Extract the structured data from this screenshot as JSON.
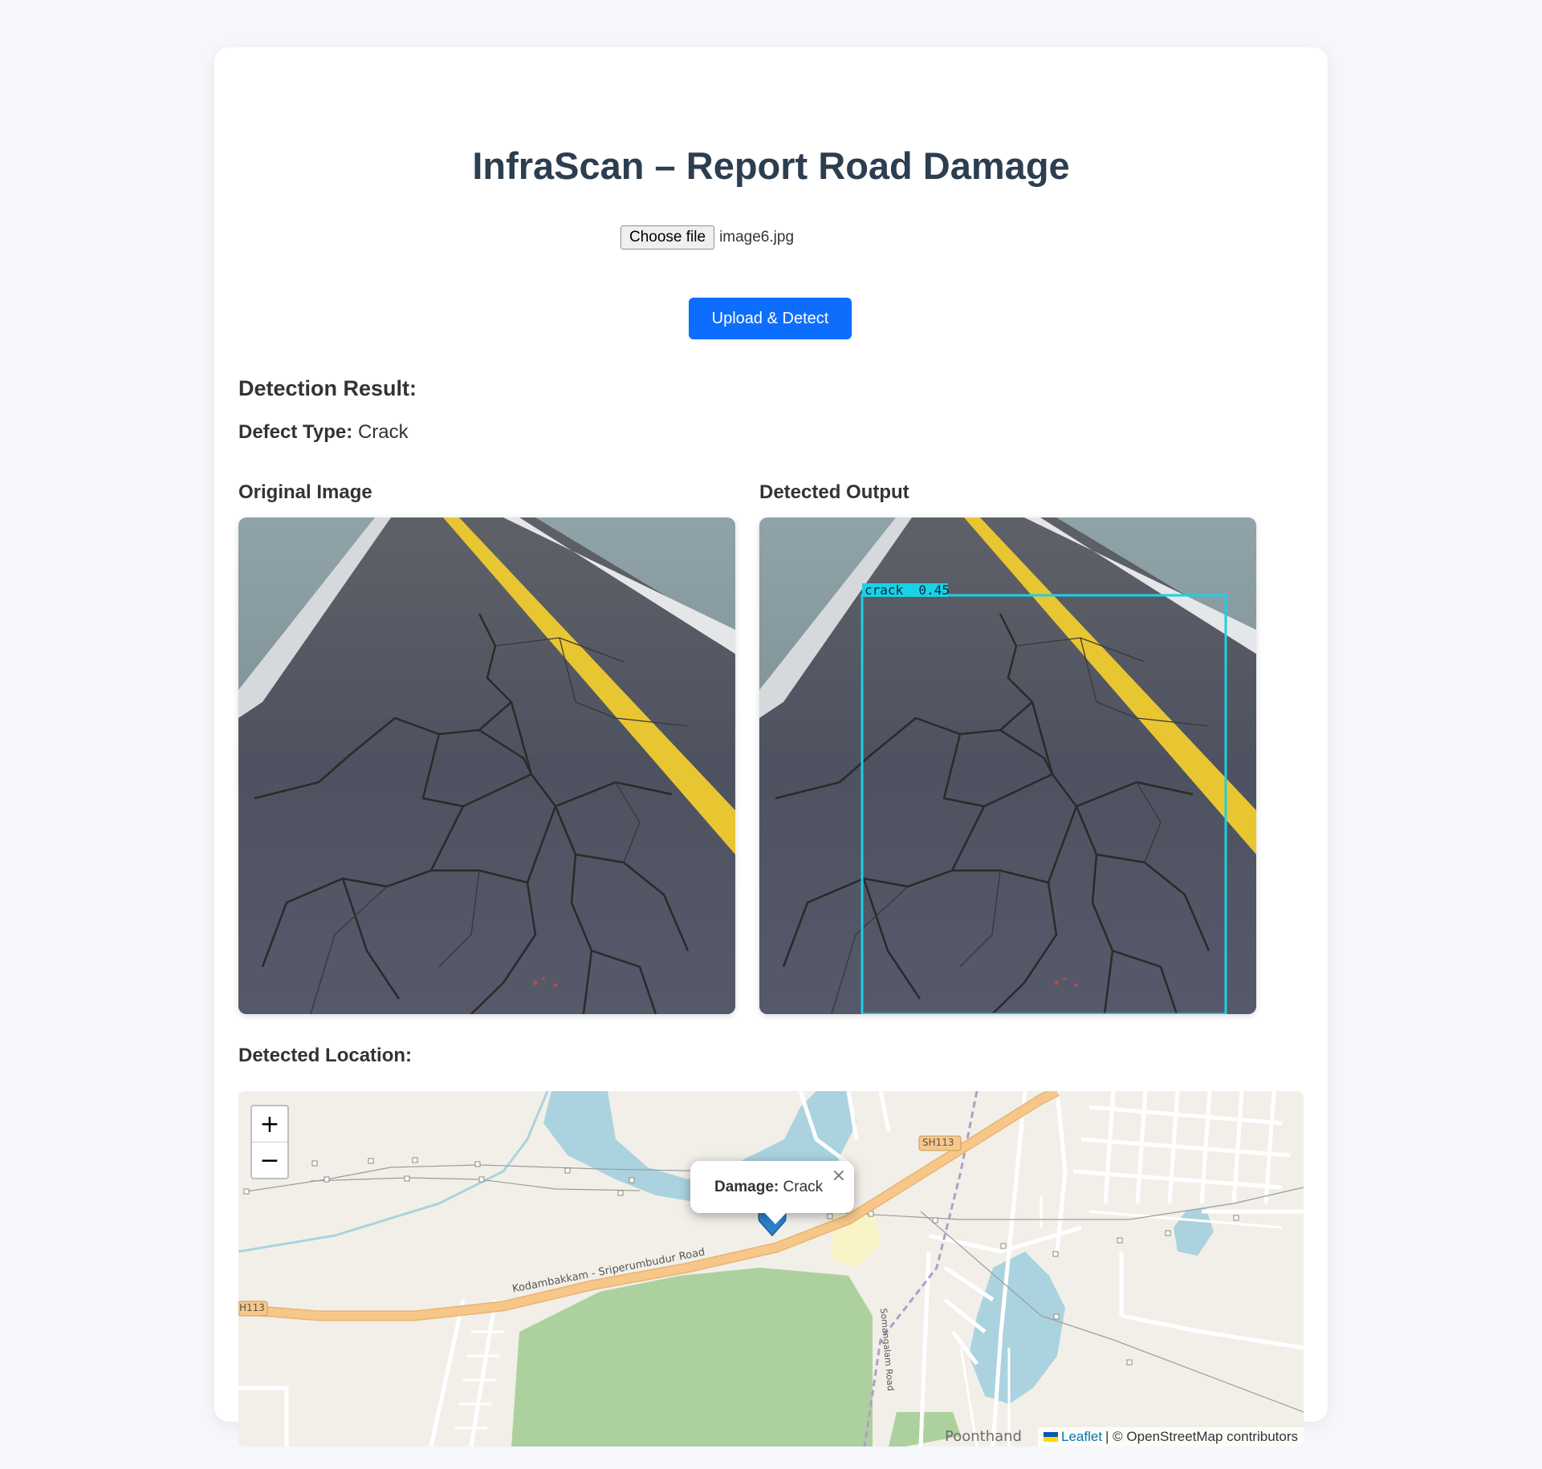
{
  "page": {
    "title": "InfraScan – Report Road Damage"
  },
  "upload": {
    "choose_label": "Choose file",
    "file_name": "image6.jpg",
    "submit_label": "Upload & Detect"
  },
  "result": {
    "heading": "Detection Result:",
    "defect_label": "Defect Type:",
    "defect_value": "Crack"
  },
  "images": {
    "original_label": "Original Image",
    "detected_label": "Detected Output",
    "detection_box_label": "crack  0.45"
  },
  "location": {
    "heading": "Detected Location:",
    "zoom_in": "+",
    "zoom_out": "−",
    "popup_label": "Damage:",
    "popup_value": "Crack",
    "popup_close": "×",
    "attribution_leaflet": "Leaflet",
    "attribution_rest": "| © OpenStreetMap contributors",
    "map_labels": {
      "road_main": "Kodambakkam - Sriperumbudur Road",
      "sh_shield_1": "SH113",
      "sh_shield_2": "H113",
      "road_side": "Somangalam Road",
      "town": "Poonthand"
    }
  },
  "colors": {
    "primary_button": "#0d6efd",
    "title": "#2c3e50",
    "detection_box": "#1ad1e6",
    "marker": "#2a81cb",
    "water": "#aad3df",
    "forest": "#add19e",
    "highway": "#f7c78a"
  }
}
